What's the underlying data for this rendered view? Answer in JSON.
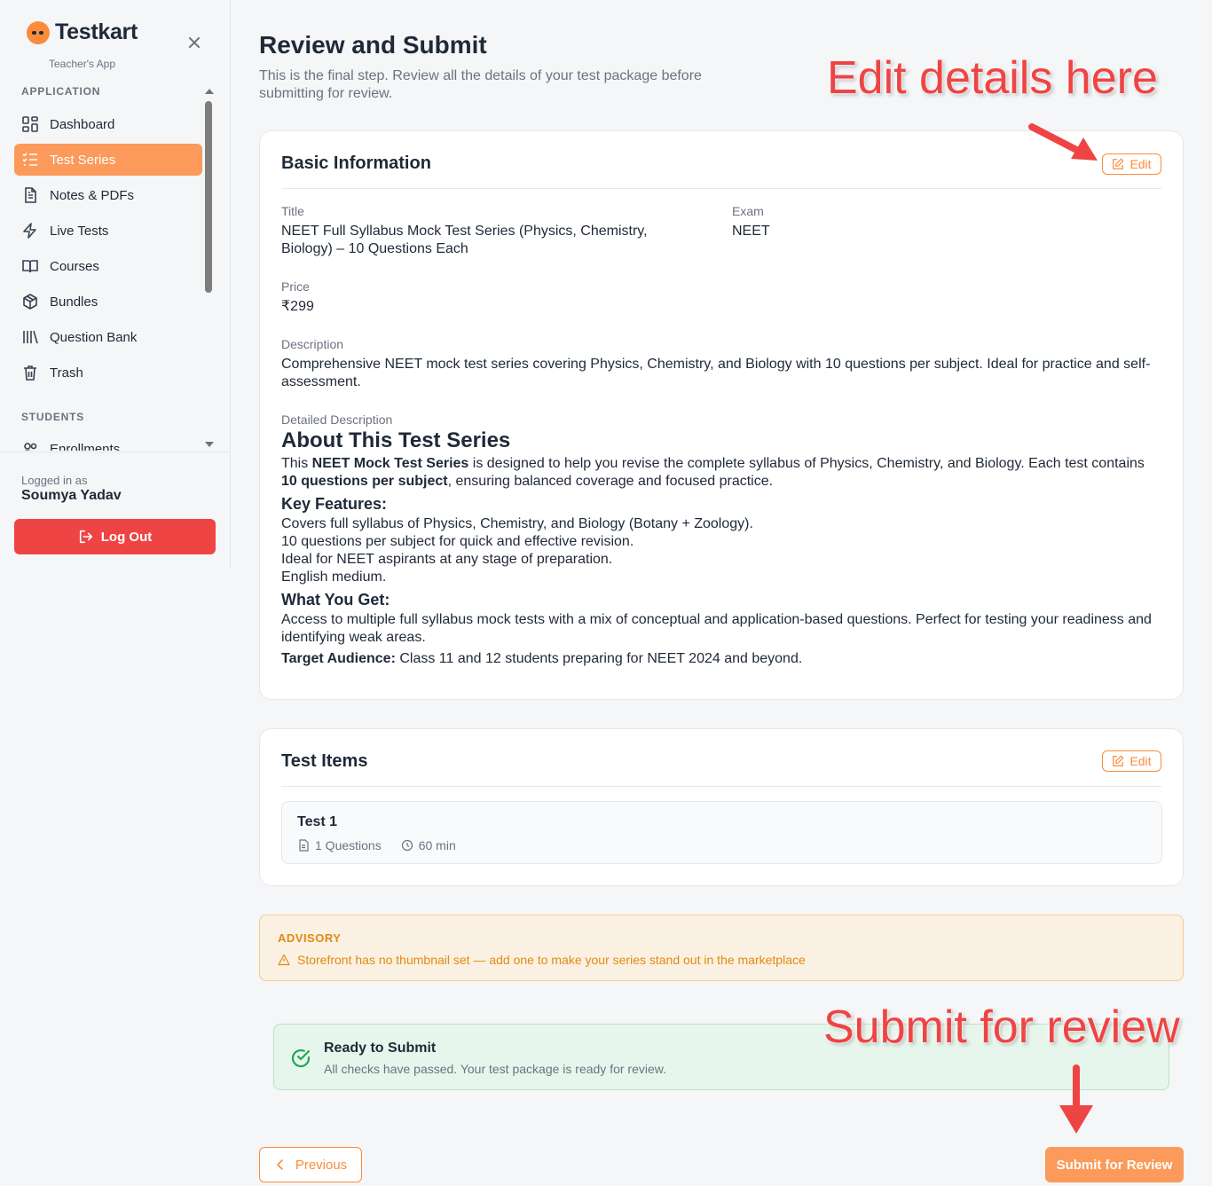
{
  "brand": {
    "name": "Testkart",
    "subtitle": "Teacher's App"
  },
  "sidebar": {
    "sections": [
      {
        "label": "APPLICATION"
      },
      {
        "label": "STUDENTS"
      }
    ],
    "items": [
      {
        "label": "Dashboard",
        "icon": "dashboard-icon"
      },
      {
        "label": "Test Series",
        "icon": "checklist-icon",
        "active": true
      },
      {
        "label": "Notes & PDFs",
        "icon": "file-text-icon"
      },
      {
        "label": "Live Tests",
        "icon": "lightning-icon"
      },
      {
        "label": "Courses",
        "icon": "book-open-icon"
      },
      {
        "label": "Bundles",
        "icon": "package-icon"
      },
      {
        "label": "Question Bank",
        "icon": "library-icon"
      },
      {
        "label": "Trash",
        "icon": "trash-icon"
      },
      {
        "label": "Enrollments",
        "icon": "users-icon"
      }
    ],
    "logged_in_label": "Logged in as",
    "user_name": "Soumya Yadav",
    "logout_label": "Log Out"
  },
  "main": {
    "title": "Review and Submit",
    "subtitle": "This is the final step. Review all the details of your test package before submitting for review.",
    "basic_info": {
      "heading": "Basic Information",
      "edit_label": "Edit",
      "title_label": "Title",
      "title_value": "NEET Full Syllabus Mock Test Series (Physics, Chemistry, Biology) – 10 Questions Each",
      "exam_label": "Exam",
      "exam_value": "NEET",
      "price_label": "Price",
      "price_value": "₹299",
      "description_label": "Description",
      "description_value": "Comprehensive NEET mock test series covering Physics, Chemistry, and Biology with 10 questions per subject. Ideal for practice and self-assessment.",
      "detailed_label": "Detailed Description",
      "detailed": {
        "h_about": "About This Test Series",
        "intro_1": "This ",
        "intro_bold_1": "NEET Mock Test Series",
        "intro_2": " is designed to help you revise the complete syllabus of Physics, Chemistry, and Biology. Each test contains ",
        "intro_bold_2": "10 questions per subject",
        "intro_3": ", ensuring balanced coverage and focused practice.",
        "h_features": "Key Features:",
        "features": [
          "Covers full syllabus of Physics, Chemistry, and Biology (Botany + Zoology).",
          "10 questions per subject for quick and effective revision.",
          "Ideal for NEET aspirants at any stage of preparation.",
          "English medium."
        ],
        "h_get": "What You Get:",
        "get_text": "Access to multiple full syllabus mock tests with a mix of conceptual and application-based questions. Perfect for testing your readiness and identifying weak areas.",
        "audience_label": "Target Audience:",
        "audience_text": " Class 11 and 12 students preparing for NEET 2024 and beyond."
      }
    },
    "test_items": {
      "heading": "Test Items",
      "edit_label": "Edit",
      "items": [
        {
          "title": "Test 1",
          "questions": "1 Questions",
          "duration": "60 min"
        }
      ]
    },
    "advisory": {
      "title": "ADVISORY",
      "text": "Storefront has no thumbnail set — add one to make your series stand out in the marketplace"
    },
    "ready": {
      "title": "Ready to Submit",
      "text": "All checks have passed. Your test package is ready for review."
    },
    "previous_label": "Previous",
    "submit_label": "Submit for Review"
  },
  "annotations": {
    "edit_hint": "Edit details here",
    "submit_hint": "Submit for review"
  },
  "colors": {
    "accent": "#fb8c3a",
    "active_nav": "#fb9a5a",
    "logout": "#ef4444",
    "advisory": "#e08a14",
    "success": "#22a55a",
    "annotation": "#ef4444"
  }
}
